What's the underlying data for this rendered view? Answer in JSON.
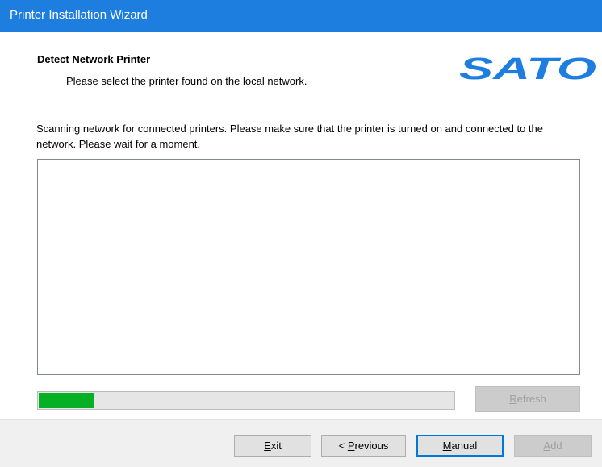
{
  "window": {
    "title": "Printer Installation Wizard"
  },
  "header": {
    "title": "Detect Network Printer",
    "subtitle": "Please select the printer found on the local network.",
    "logo_text": "SATO",
    "logo_color": "#1e7ee0"
  },
  "description": "Scanning network for connected printers. Please make sure that the printer is turned on and connected to the network. Please wait for a moment.",
  "printer_list": {
    "items": []
  },
  "progress": {
    "fraction": 0.135,
    "color": "#06b025"
  },
  "buttons": {
    "refresh": {
      "pre": "",
      "mnemonic": "R",
      "post": "efresh",
      "enabled": false
    },
    "exit": {
      "pre": "",
      "mnemonic": "E",
      "post": "xit",
      "enabled": true
    },
    "previous": {
      "pre": "< ",
      "mnemonic": "P",
      "post": "revious",
      "enabled": true
    },
    "manual": {
      "pre": "",
      "mnemonic": "M",
      "post": "anual",
      "enabled": true
    },
    "add": {
      "pre": "",
      "mnemonic": "A",
      "post": "dd",
      "enabled": false
    }
  }
}
